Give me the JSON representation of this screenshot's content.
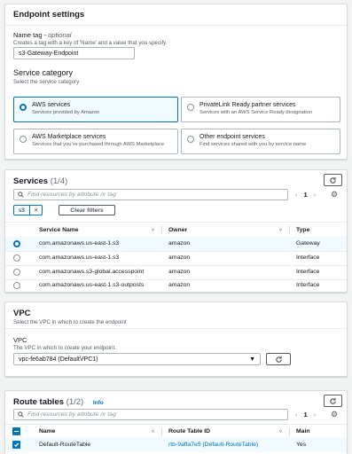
{
  "endpoint_settings": {
    "title": "Endpoint settings",
    "name_tag_label": "Name tag",
    "name_tag_optional": "optional",
    "name_tag_desc": "Creates a tag with a key of 'Name' and a value that you specify.",
    "name_tag_value": "s3-Gateway-Endpoint",
    "service_category_title": "Service category",
    "service_category_desc": "Select the service category",
    "categories": [
      {
        "title": "AWS services",
        "desc": "Services provided by Amazon",
        "selected": true
      },
      {
        "title": "PrivateLink Ready partner services",
        "desc": "Services with an AWS Service Ready designation",
        "selected": false
      },
      {
        "title": "AWS Marketplace services",
        "desc": "Services that you've purchased through AWS Marketplace",
        "selected": false
      },
      {
        "title": "Other endpoint services",
        "desc": "Find services shared with you by service name",
        "selected": false
      }
    ]
  },
  "services": {
    "title": "Services",
    "count": "(1/4)",
    "search_placeholder": "Find resources by attribute or tag",
    "filter_token": "s3",
    "clear_filters": "Clear filters",
    "page": "1",
    "columns": [
      "Service Name",
      "Owner",
      "Type"
    ],
    "rows": [
      {
        "name": "com.amazonaws.us-east-1.s3",
        "owner": "amazon",
        "type": "Gateway",
        "selected": true
      },
      {
        "name": "com.amazonaws.us-east-1.s3",
        "owner": "amazon",
        "type": "Interface",
        "selected": false
      },
      {
        "name": "com.amazonaws.s3-global.accesspoint",
        "owner": "amazon",
        "type": "Interface",
        "selected": false
      },
      {
        "name": "com.amazonaws.us-east-1.s3-outposts",
        "owner": "amazon",
        "type": "Interface",
        "selected": false
      }
    ]
  },
  "vpc": {
    "title": "VPC",
    "desc": "Select the VPC in which to create the endpoint",
    "field_label": "VPC",
    "field_desc": "The VPC in which to create your endpoint.",
    "selected_value": "vpc-fe6ab784 (DefaultVPC1)"
  },
  "route_tables": {
    "title": "Route tables",
    "count": "(1/2)",
    "info": "Info",
    "search_placeholder": "Find resources by attribute or tag",
    "page": "1",
    "columns": [
      "Name",
      "Route Table ID",
      "Main"
    ],
    "rows": [
      {
        "name": "Default-RouteTable",
        "id": "rtb-9affa7e5 (Default-RouteTable)",
        "main": "Yes",
        "selected": true
      }
    ]
  },
  "colors": {
    "accent": "#0073bb",
    "border": "#aab7b8",
    "background": "#f2f3f3"
  }
}
